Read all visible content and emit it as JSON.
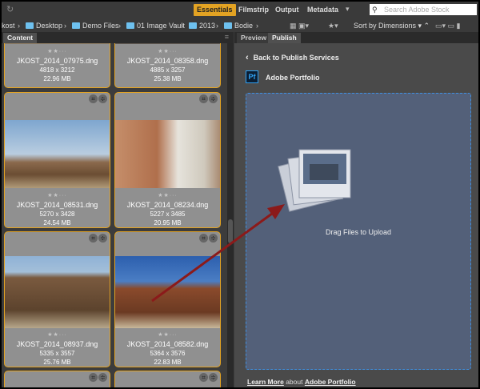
{
  "workspaces": [
    {
      "label": "Essentials",
      "active": true
    },
    {
      "label": "Filmstrip"
    },
    {
      "label": "Output"
    },
    {
      "label": "Metadata"
    }
  ],
  "search": {
    "placeholder": "Search Adobe Stock"
  },
  "breadcrumb": [
    "kost",
    "Desktop",
    "Demo Files",
    "01 Image Vault",
    "2013",
    "Bodie"
  ],
  "toolbar": {
    "sort_label": "Sort by Dimensions"
  },
  "left_tabs": [
    "Content"
  ],
  "right_tabs": [
    "Preview",
    "Publish"
  ],
  "cards": [
    {
      "name": "JKOST_2014_07975.dng",
      "dims": "4818 x 3212",
      "size": "22.96 MB",
      "rating": 2
    },
    {
      "name": "JKOST_2014_08358.dng",
      "dims": "4885 x 3257",
      "size": "25.38 MB",
      "rating": 2
    },
    {
      "name": "JKOST_2014_08531.dng",
      "dims": "5270 x 3428",
      "size": "24.54 MB",
      "rating": 2
    },
    {
      "name": "JKOST_2014_08234.dng",
      "dims": "5227 x 3485",
      "size": "20.95 MB",
      "rating": 2
    },
    {
      "name": "JKOST_2014_08937.dng",
      "dims": "5335 x 3557",
      "size": "25.76 MB",
      "rating": 2
    },
    {
      "name": "JKOST_2014_08582.dng",
      "dims": "5364 x 3576",
      "size": "22.83 MB",
      "rating": 2
    }
  ],
  "publish": {
    "back_label": "Back to Publish Services",
    "pf_icon": "Pf",
    "service_name": "Adobe Portfolio",
    "drop_text": "Drag Files to Upload",
    "learn_more": "Learn More",
    "about": "about",
    "about_link": "Adobe Portfolio"
  },
  "colors": {
    "accent": "#e3a323",
    "drop": "#536079",
    "arrow": "#8b1a1a"
  }
}
